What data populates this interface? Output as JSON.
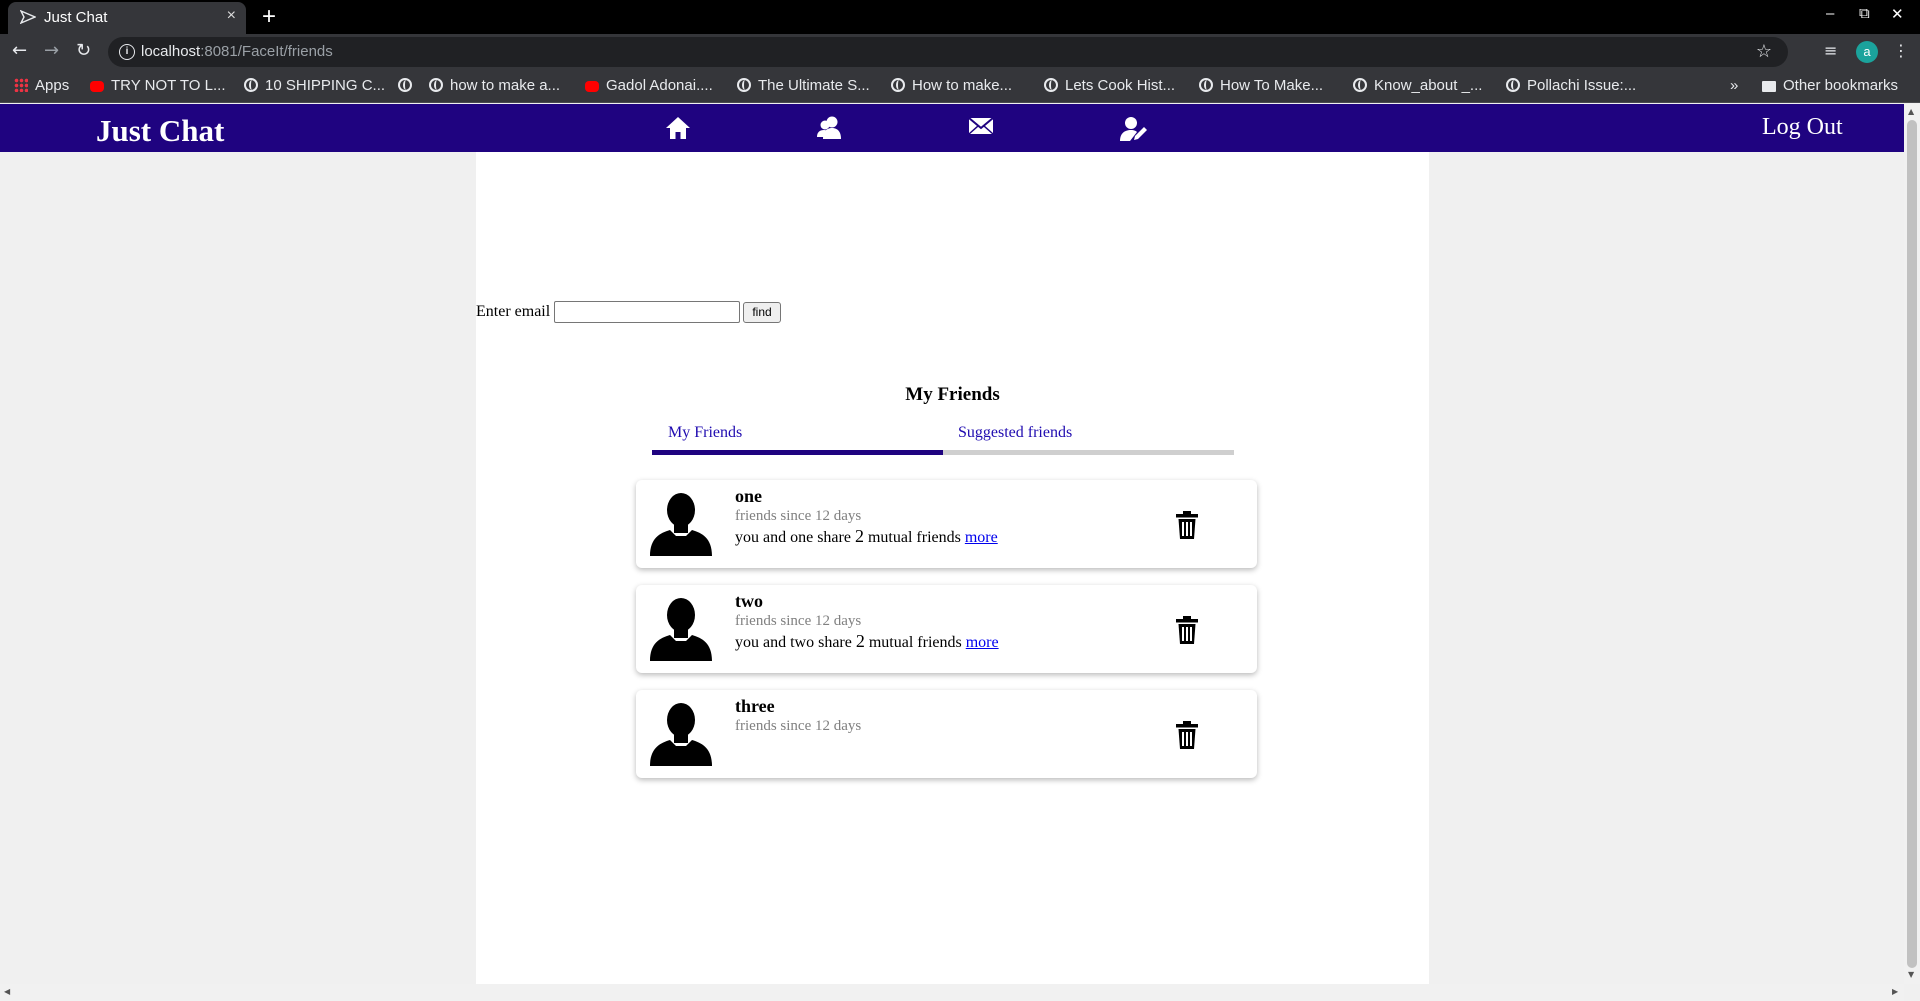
{
  "browser": {
    "tab_title": "Just Chat",
    "tab_close": "×",
    "new_tab": "+",
    "url_host": "localhost",
    "url_rest": ":8081/FaceIt/friends",
    "window_controls": [
      "–",
      "⧉",
      "✕"
    ],
    "profile_initial": "a",
    "bookmarks": [
      {
        "label": "Apps",
        "icon": "apps-icon"
      },
      {
        "label": "TRY NOT TO L...",
        "icon": "youtube-icon"
      },
      {
        "label": "10 SHIPPING C...",
        "icon": "globe-icon"
      },
      {
        "label": "",
        "icon": "globe-icon"
      },
      {
        "label": "how to make a...",
        "icon": "globe-icon"
      },
      {
        "label": "Gadol Adonai....",
        "icon": "youtube-icon"
      },
      {
        "label": "The Ultimate S...",
        "icon": "globe-icon"
      },
      {
        "label": "How to make...",
        "icon": "globe-icon"
      },
      {
        "label": "Lets Cook Hist...",
        "icon": "globe-icon"
      },
      {
        "label": "How To Make...",
        "icon": "globe-icon"
      },
      {
        "label": "Know_about _...",
        "icon": "globe-icon"
      },
      {
        "label": "Pollachi Issue:...",
        "icon": "globe-icon"
      }
    ],
    "bookmarks_overflow": "»",
    "other_bookmarks": "Other bookmarks"
  },
  "app": {
    "brand": "Just Chat",
    "nav_icons": [
      "home-icon",
      "friends-icon",
      "mail-icon",
      "edit-profile-icon"
    ],
    "logout": "Log Out",
    "colors": {
      "navbar": "#1f0380",
      "link": "#1f0bb0"
    }
  },
  "search": {
    "label": "Enter email",
    "value": "",
    "button": "find"
  },
  "friends_section": {
    "title": "My Friends",
    "tabs": [
      {
        "label": "My Friends",
        "active": true
      },
      {
        "label": "Suggested friends",
        "active": false
      }
    ]
  },
  "friends": [
    {
      "name": "one",
      "since": "friends since 12 days",
      "mutual_prefix": "you and one share",
      "mutual_count": "2",
      "mutual_suffix": "mutual friends",
      "more": "more"
    },
    {
      "name": "two",
      "since": "friends since 12 days",
      "mutual_prefix": "you and two share",
      "mutual_count": "2",
      "mutual_suffix": "mutual friends",
      "more": "more"
    },
    {
      "name": "three",
      "since": "friends since 12 days"
    }
  ]
}
